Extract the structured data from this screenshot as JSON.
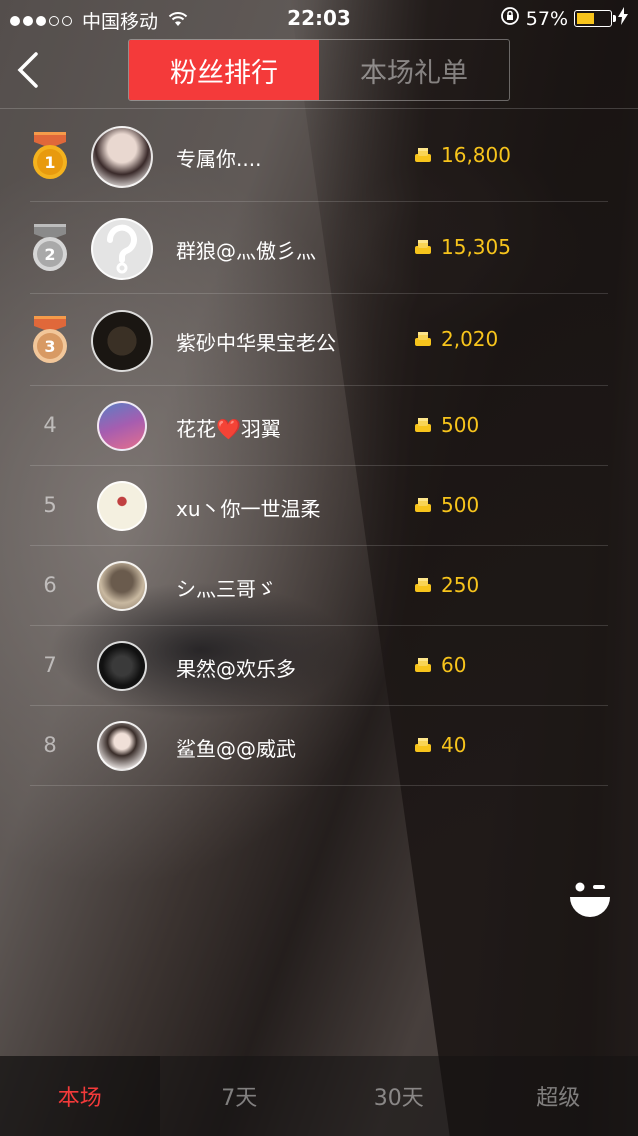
{
  "status_bar": {
    "carrier": "中国移动",
    "time": "22:03",
    "battery_percent": "57%",
    "battery_level": 0.57
  },
  "header": {
    "back_icon": "chevron-left-icon",
    "tabs": [
      {
        "label": "粉丝排行",
        "active": true
      },
      {
        "label": "本场礼单",
        "active": false
      }
    ]
  },
  "ranking": [
    {
      "rank": "1",
      "name": "专属你....",
      "amount": "16,800",
      "medal": "gold"
    },
    {
      "rank": "2",
      "name": "群狼@灬傲彡灬",
      "amount": "15,305",
      "medal": "silver"
    },
    {
      "rank": "3",
      "name": "紫砂中华果宝老公",
      "amount": "2,020",
      "medal": "bronze"
    },
    {
      "rank": "4",
      "name": "花花❤️羽翼",
      "amount": "500"
    },
    {
      "rank": "5",
      "name": "xu丶你一世温柔",
      "amount": "500"
    },
    {
      "rank": "6",
      "name": "シ灬三哥ゞ",
      "amount": "250"
    },
    {
      "rank": "7",
      "name": "果然@欢乐多",
      "amount": "60"
    },
    {
      "rank": "8",
      "name": "鲨鱼@@威武",
      "amount": "40"
    }
  ],
  "bottom_tabs": [
    {
      "label": "本场",
      "active": true
    },
    {
      "label": "7天"
    },
    {
      "label": "30天"
    },
    {
      "label": "超级"
    }
  ],
  "colors": {
    "accent": "#f43a3a",
    "gold": "#f7c41c"
  }
}
